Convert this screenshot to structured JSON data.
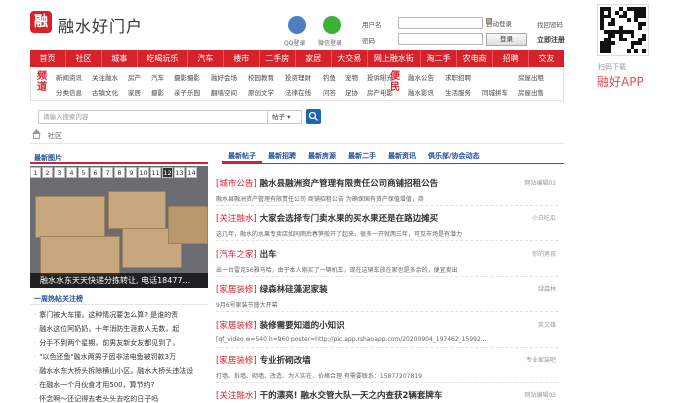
{
  "header": {
    "logo_char": "融",
    "site_title": "融水好门户",
    "qq_login": "QQ登录",
    "wechat_login": "微信登录",
    "username_label": "用户名",
    "password_label": "密码",
    "remember_label": "自动登录",
    "forgot_label": "找回密码",
    "login_button": "登录",
    "register_link": "立即注册"
  },
  "nav": [
    "首页",
    "社区",
    "城事",
    "吃喝玩乐",
    "汽车",
    "楼市",
    "二手房",
    "家居",
    "大交易",
    "网上融水街",
    "淘二手",
    "农电商",
    "招聘",
    "交友"
  ],
  "subnav": {
    "channel_head": "频道",
    "channel_rows": [
      [
        "新闻资讯",
        "关注融水",
        "房产",
        "汽车",
        "摄影摄影",
        "融好会场",
        "校园教育",
        "投资理财",
        "钓鱼",
        "宠物",
        "投诉曝光"
      ],
      [
        "分类信息",
        "古镇文化",
        "家居",
        "摄影",
        "亲子乐园",
        "翻墙空间",
        "原创文学",
        "法律在线",
        "问答",
        "足协",
        "房产电影"
      ]
    ],
    "convenience_head": "便民",
    "convenience_rows": [
      [
        "融水公告",
        "求职招聘",
        "房屋出租"
      ],
      [
        "融水影讯",
        "生活服务",
        "同城拼车",
        "房屋出售"
      ]
    ]
  },
  "search": {
    "placeholder": "请输入搜索内容",
    "select_value": "帖子 ▾"
  },
  "breadcrumb": {
    "label": "社区"
  },
  "left": {
    "tab_label": "最新图片",
    "slide_numbers": [
      "1",
      "2",
      "3",
      "4",
      "5",
      "6",
      "7",
      "8",
      "9",
      "10",
      "11",
      "12",
      "13",
      "14"
    ],
    "active_slide": "12",
    "slide_caption": "融水水东天天快递分拣转让, 电话18477...",
    "hot_title": "一周热帖关注榜",
    "hot_list": [
      "寨门被大车撞，这种情况要怎么算? 是谁的责",
      "融水这位阿奶奶，十年消防生涯救人无数，起",
      "分手不到两个星期，前男友新女友都见到了，",
      "\"以色还鱼\"融水两男子因非法电鱼被罚款3万",
      "融水水东大桥头拆除横山小区，融水大桥头违法设",
      "在融水一个月伙食才用500，算节约?",
      "怀念啊～还记得去老头头去吃的日子吗"
    ]
  },
  "right": {
    "tabs": [
      "最新帖子",
      "最新招聘",
      "最新房源",
      "最新二手",
      "最新资讯",
      "俱乐部/协会动态"
    ],
    "articles": [
      {
        "tag": "[城市公告]",
        "title": "融水县融洲资产管理有限责任公司商铺招租公告",
        "desc": "融水县融洲资产管理有限责任公司 商铺招租公告 为确保国有资产保值增值，商",
        "meta": "网站编辑03"
      },
      {
        "tag": "[关注融水]",
        "title": "大家会选择专门卖水果的买水果还是在路边摊买",
        "desc": "这几年，融水的水果专卖店如同雨后春笋般开了起来，很多一开就两三年，可见市场是有潜力",
        "meta": "小白吃瓜"
      },
      {
        "tag": "[汽车之家]",
        "title": "出车",
        "desc": "出一台雷克56雅马哈，由于本人刚买了一辆机车，现在这辆车放在家也是多余的，便宜卖出",
        "meta": "你的男孩"
      },
      {
        "tag": "[家居装修]",
        "title": "绿森林硅藻泥家装",
        "desc": "9月6号家装节盛大开幕",
        "meta": "绿森林"
      },
      {
        "tag": "[家居装修]",
        "title": "装修需要知道的小知识",
        "desc": "[qf_video w=540 h=960 poster=http://pic.app.rshaoapp.com/20200904_197462_15992...",
        "meta": "英文雄"
      },
      {
        "tag": "[家居装修]",
        "title": "专业折砌改墙",
        "desc": "打墙、拆墙、砌墙、改造、为人实在、价格合理 有需要联系：15877207819",
        "meta": "专业家装吧"
      },
      {
        "tag": "[关注融水]",
        "title": "干的漂亮! 融水交管大队一天之内查获2辆套牌车",
        "desc": "",
        "meta": "网站编辑03"
      }
    ]
  },
  "app": {
    "qr_label": "扫码下载",
    "app_label": "融好APP"
  }
}
